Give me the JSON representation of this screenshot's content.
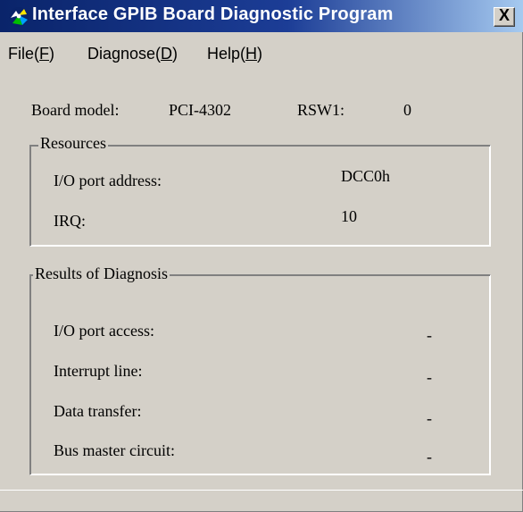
{
  "window": {
    "title": "Interface GPIB Board Diagnostic Program",
    "close_label": "X"
  },
  "menu": {
    "file": {
      "pre": "File(",
      "key": "F",
      "post": ")"
    },
    "diagnose": {
      "pre": "Diagnose(",
      "key": "D",
      "post": ")"
    },
    "help": {
      "pre": "Help(",
      "key": "H",
      "post": ")"
    }
  },
  "board": {
    "model_label": "Board model:",
    "model_value": "PCI-4302",
    "rsw_label": "RSW1:",
    "rsw_value": "0"
  },
  "resources": {
    "title": "Resources",
    "io_label": "I/O port address:",
    "io_value": "DCC0h",
    "irq_label": "IRQ:",
    "irq_value": "10"
  },
  "results": {
    "title": "Results of Diagnosis",
    "rows": [
      {
        "label": "I/O port access:",
        "value": "-"
      },
      {
        "label": "Interrupt line:",
        "value": "-"
      },
      {
        "label": "Data transfer:",
        "value": "-"
      },
      {
        "label": "Bus master circuit:",
        "value": "-"
      }
    ]
  },
  "colors": {
    "title_bar_start": "#0a246a",
    "title_bar_end": "#a6caf0",
    "window_face": "#d4d0c8"
  },
  "icons": {
    "app": "gpib-program-icon",
    "close": "close-icon"
  }
}
